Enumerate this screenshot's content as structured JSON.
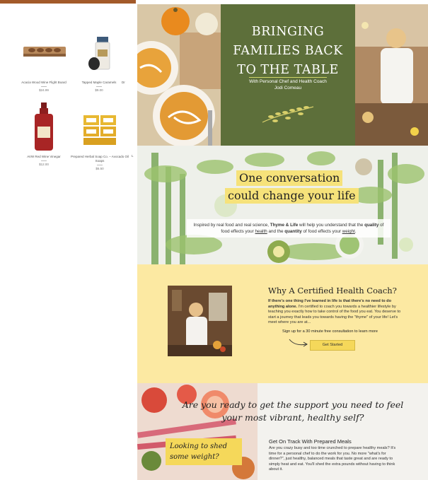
{
  "shop": {
    "products": [
      {
        "name": "Acacia Wood Wine Flight Board",
        "price": "$24.99"
      },
      {
        "name": "Tapped Maple Caramels",
        "price": "$9.00"
      },
      {
        "name": "Dr",
        "price": ""
      },
      {
        "name": "AVW Red Wine Vinegar",
        "price": "$12.00"
      },
      {
        "name": "Prepared Herbal Soap Co. – Avocado Oil Soaps",
        "price": "$6.50"
      },
      {
        "name": "L",
        "price": ""
      }
    ]
  },
  "hero": {
    "title_lines": [
      "BRINGING",
      "FAMILIES BACK",
      "TO THE TABLE"
    ],
    "subtitle_line1": "With Personal Chef and Health Coach",
    "subtitle_line2": "Jodi Comeau"
  },
  "convo": {
    "heading_line1": "One conversation",
    "heading_line2": "could change your life",
    "body_pre": "Inspired by real food and real science,",
    "brand": "Thyme & Life",
    "body_mid": "will help you understand that the",
    "quality": "quality",
    "body_mid2": "of food effects your",
    "health": "health",
    "body_mid3": "and the",
    "quantity": "quantity",
    "body_mid4": "of food effects your",
    "weight": "weight",
    "body_end": "."
  },
  "coach": {
    "heading": "Why A Certified Health Coach?",
    "bold_intro": "If there's one thing I've learned in life is that there's no need to do anything alone.",
    "body": "I'm certified to coach you towards a healthier lifestyle by teaching you exactly how to take control of the food you eat. You deserve to start a journey that leads you towards having the \"thyme\" of your life! Let's meet where you are at...",
    "signup": "Sign up for a 30 minute free consultation to learn more",
    "cta": "Get Started"
  },
  "ready": {
    "heading_line1": "Are you ready to get the support you need to feel",
    "heading_line2": "your most vibrant, healthy self?",
    "callout_line1": "Looking to shed",
    "callout_line2": "some weight?",
    "sub_heading": "Get On Track With Prepared Meals",
    "body": "Are you crazy busy and too time crunched to prepare healthy meals? It's time for a personal chef to do the work for you. No more \"what's for dinner?\", just healthy, balanced meals that taste great and are ready to simply heat and eat. You'll shed the extra pounds without having to think about it."
  },
  "colors": {
    "hero_green": "#5d6f3a",
    "accent_yellow": "#f5d85a",
    "coach_bg": "#fce9a2",
    "shop_bar": "#a35a2a"
  }
}
